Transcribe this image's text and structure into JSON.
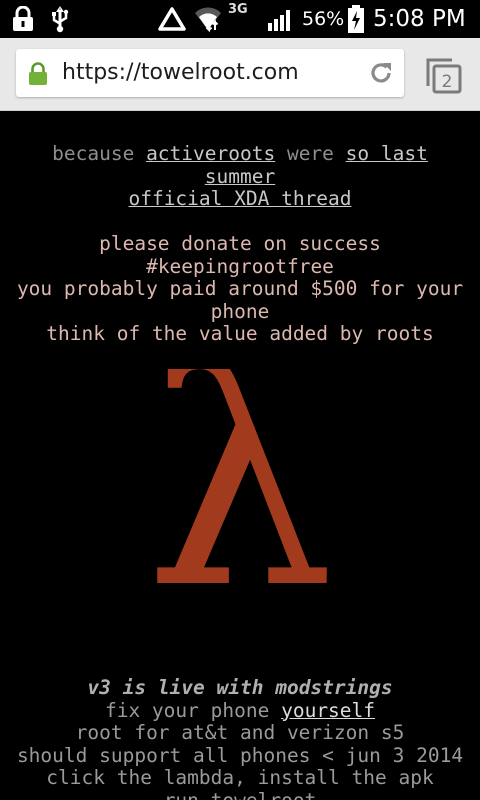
{
  "status_bar": {
    "battery_percent": "56%",
    "network_type": "3G",
    "time": "5:08 PM",
    "icons": [
      "lock-icon",
      "usb-icon",
      "warning-icon",
      "wifi-icon",
      "signal-icon",
      "battery-charging-icon"
    ]
  },
  "browser": {
    "url": "https://towelroot.com",
    "tab_count": "2",
    "icons": [
      "secure-lock-icon",
      "reload-icon",
      "tabs-icon"
    ]
  },
  "content": {
    "intro": {
      "because": "because",
      "activeroots_link": "activeroots",
      "were": "were",
      "so_last_summer_link_1": "so last",
      "so_last_summer_link_2": "summer",
      "xda_link": "official XDA thread"
    },
    "donate": {
      "line1": "please donate on success",
      "line2": "#keepingrootfree",
      "line3": "you probably paid around $500 for your",
      "line4": "phone",
      "line5": "think of the value added by roots"
    },
    "lambda_symbol": "λ",
    "lambda_color": "#a23a1e",
    "bottom": {
      "headline": "v3 is live with modstrings",
      "fix_prefix": "fix your phone",
      "fix_link": "yourself",
      "line2": "root for at&t and verizon s5",
      "line3": "should support all phones < jun 3 2014",
      "line4": "click the lambda, install the apk",
      "line5": "run towelroot"
    }
  }
}
